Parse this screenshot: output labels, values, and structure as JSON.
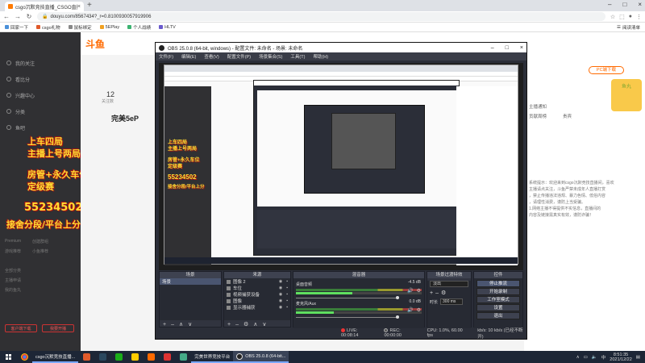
{
  "chrome": {
    "tab_title": "csgo沉默竞技直播_CSGO直播...",
    "tab_close": "×",
    "new_tab": "+",
    "url": "douyu.com/8567434?_r=0.8100930057919906",
    "back": "←",
    "forward": "→",
    "reload": "↻",
    "menu": "⋮",
    "minimize": "–",
    "maximize": "□",
    "close": "×",
    "bookmarks": [
      {
        "label": "回家一下",
        "color": "#4a90d9"
      },
      {
        "label": "csgo礼物",
        "color": "#e05a2b"
      },
      {
        "label": "鼠标绑定",
        "color": "#888888"
      },
      {
        "label": "5EPlay",
        "color": "#f0a020"
      },
      {
        "label": "个人战绩",
        "color": "#3cb371"
      },
      {
        "label": "HLTV",
        "color": "#6a5acd"
      }
    ],
    "reading_list": "阅读清单"
  },
  "douyu": {
    "logo": "斗鱼",
    "sidebar_items": [
      "我的关注",
      "看比分",
      "兴趣中心",
      "分类",
      "鱼吧"
    ],
    "promo_lines": [
      "上车四局",
      "主播上号两局",
      "房管+永久车位",
      "定级赛",
      "55234502",
      "接舍分段/平台上分"
    ],
    "sidebar_small": [
      "Premium",
      "创建群组",
      "游戏推荐",
      "小鱼推荐",
      "全部分类",
      "主播申请",
      "我的鱼丸"
    ],
    "sidebar_btn_left": "客户端下载",
    "sidebar_btn_right": "我要开播",
    "count": "12",
    "count_label": "关注数",
    "anchor_name": "完美5eP",
    "pc_button": "PC端下载",
    "right_tabs": [
      "主播通知",
      "贡献周榜",
      "贵宾"
    ],
    "gift_label": "鱼丸",
    "chat_lines": [
      "系统提示：欢迎来到csgo沉默竞技直播间，喜欢",
      "主播请点关注，斗鱼严禁未成年人直播打赏",
      "，禁止传播违法违规、暴力色情、低俗内容",
      "，请理性消费，谨防上当受骗。",
      "1.网络主播不得提供不实信息，直播间的",
      "内容及链接需真实有效，谨防诈骗！"
    ]
  },
  "obs": {
    "title": "OBS 25.0.8 (64-bit, windows) - 配置文件: 未命名 - 场景: 未命名",
    "menu": [
      "文件(F)",
      "编辑(E)",
      "查看(V)",
      "配置文件(P)",
      "场景集合(S)",
      "工具(T)",
      "帮助(H)"
    ],
    "docks": {
      "scenes": {
        "title": "场景",
        "items": [
          "场景"
        ]
      },
      "sources": {
        "title": "来源",
        "items": [
          "图像 2",
          "车位",
          "视频捕获设备",
          "图像",
          "显示器捕获"
        ]
      },
      "mixer": {
        "title": "混音器",
        "tracks": [
          {
            "name": "桌面音频",
            "db": "-4.5 dB",
            "level": 0.45
          },
          {
            "name": "麦克风/Aux",
            "db": "0.0 dB",
            "level": 0.3
          }
        ]
      },
      "transitions": {
        "title": "场景过渡特效",
        "selected": "淡出",
        "duration_label": "时长",
        "duration": "300 ms"
      },
      "controls": {
        "title": "控件",
        "buttons": [
          "停止推流",
          "开始录制",
          "工作室模式",
          "设置",
          "退出"
        ]
      }
    },
    "dock_controls": {
      "add": "+",
      "remove": "–",
      "settings": "⚙",
      "up": "∧",
      "down": "∨"
    },
    "status": {
      "live_label": "LIVE:",
      "live_time": "00:08:14",
      "rec_label": "REC:",
      "rec_time": "00:00:00",
      "cpu": "CPU: 1.0%, 60.00 fps",
      "bitrate": "kb/s: 10 kb/s (已经不断开)"
    }
  },
  "taskbar": {
    "windows": [
      {
        "label": "csgo沉默竞技直播...",
        "active": false
      },
      {
        "label": "完美世界竞技平台",
        "active": false
      },
      {
        "label": "OBS 25.0.8 (64-bit...",
        "active": true
      }
    ],
    "time": "8:51:35",
    "date": "2021/12/22",
    "input_method": "中"
  }
}
